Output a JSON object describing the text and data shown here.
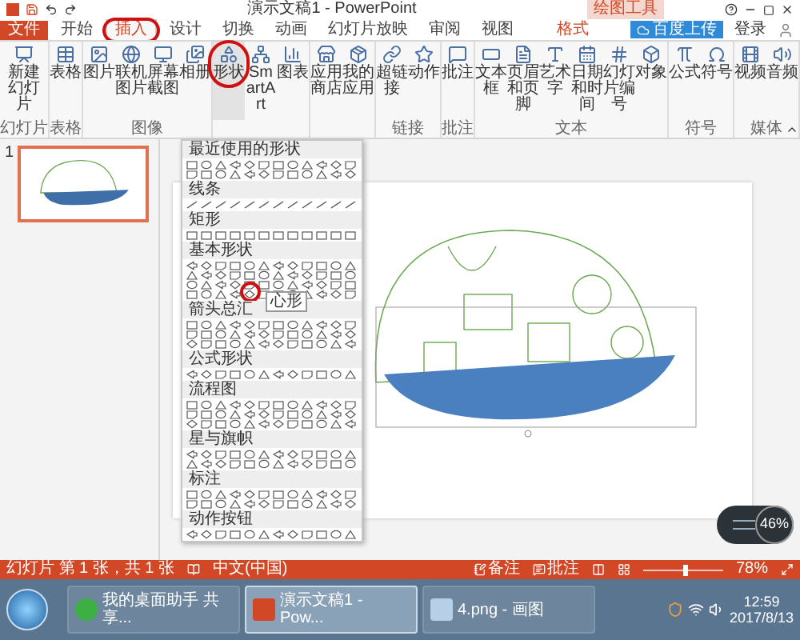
{
  "title_bar": {
    "title": "演示文稿1 - PowerPoint",
    "context_label": "绘图工具",
    "sign_in": "登录"
  },
  "upload_button": "百度上传",
  "tabs": [
    {
      "label": "文件",
      "kind": "file",
      "selected": false
    },
    {
      "label": "开始",
      "kind": "normal",
      "selected": false
    },
    {
      "label": "插入",
      "kind": "normal",
      "selected": true
    },
    {
      "label": "设计",
      "kind": "normal",
      "selected": false
    },
    {
      "label": "切换",
      "kind": "normal",
      "selected": false
    },
    {
      "label": "动画",
      "kind": "normal",
      "selected": false
    },
    {
      "label": "幻灯片放映",
      "kind": "normal",
      "selected": false
    },
    {
      "label": "审阅",
      "kind": "normal",
      "selected": false
    },
    {
      "label": "视图",
      "kind": "normal",
      "selected": false
    },
    {
      "label": "格式",
      "kind": "context",
      "selected": false
    }
  ],
  "ribbon_groups": [
    {
      "label": "幻灯片",
      "items": [
        {
          "label": "新建幻灯片",
          "kind": "large"
        }
      ]
    },
    {
      "label": "表格",
      "items": [
        {
          "label": "表格",
          "kind": "large"
        }
      ]
    },
    {
      "label": "图像",
      "items": [
        {
          "label": "图片",
          "kind": "large"
        },
        {
          "label": "联机图片",
          "kind": "large"
        },
        {
          "label": "屏幕截图",
          "kind": "large"
        },
        {
          "label": "相册",
          "kind": "large"
        }
      ]
    },
    {
      "items": [
        {
          "label": "形状",
          "kind": "open"
        },
        {
          "label": "SmartArt",
          "kind": "large"
        },
        {
          "label": "图表",
          "kind": "large"
        }
      ]
    },
    {
      "items": [
        {
          "label": "应用商店",
          "kind": "large"
        },
        {
          "label": "我的应用",
          "kind": "large"
        }
      ]
    },
    {
      "label": "链接",
      "items": [
        {
          "label": "超链接",
          "kind": "large"
        },
        {
          "label": "动作",
          "kind": "large"
        }
      ]
    },
    {
      "label": "批注",
      "items": [
        {
          "label": "批注",
          "kind": "large"
        }
      ]
    },
    {
      "label": "文本",
      "items": [
        {
          "label": "文本框",
          "kind": "large"
        },
        {
          "label": "页眉和页脚",
          "kind": "large"
        },
        {
          "label": "艺术字",
          "kind": "large"
        },
        {
          "label": "日期和时间",
          "kind": "large"
        },
        {
          "label": "幻灯片编号",
          "kind": "large"
        },
        {
          "label": "对象",
          "kind": "large"
        }
      ]
    },
    {
      "label": "符号",
      "items": [
        {
          "label": "公式",
          "kind": "large"
        },
        {
          "label": "符号",
          "kind": "large"
        }
      ]
    },
    {
      "label": "媒体",
      "items": [
        {
          "label": "视频",
          "kind": "large"
        },
        {
          "label": "音频",
          "kind": "large"
        }
      ]
    }
  ],
  "shape_gallery": {
    "sections": [
      {
        "title": "最近使用的形状"
      },
      {
        "title": "线条"
      },
      {
        "title": "矩形"
      },
      {
        "title": "基本形状",
        "tooltip": "心形"
      },
      {
        "title": "箭头总汇"
      },
      {
        "title": "公式形状"
      },
      {
        "title": "流程图"
      },
      {
        "title": "星与旗帜"
      },
      {
        "title": "标注"
      },
      {
        "title": "动作按钮"
      }
    ]
  },
  "slides_panel": {
    "slides": [
      {
        "number": "1",
        "selected": true
      }
    ]
  },
  "status_bar": {
    "slide_info": "幻灯片 第 1 张，共 1 张",
    "language": "中文(中国)",
    "notes": "备注",
    "comments": "批注",
    "zoom": {
      "level": 0.5,
      "reading": "78%"
    }
  },
  "net_meter": {
    "reading": "46%"
  },
  "taskbar": {
    "items": [
      {
        "label": "我的桌面助手 共享...",
        "selected": false
      },
      {
        "label": "演示文稿1 - Pow...",
        "selected": true
      },
      {
        "label": "4.png - 画图",
        "selected": false
      }
    ],
    "time": "12:59",
    "date": "2017/8/13"
  }
}
